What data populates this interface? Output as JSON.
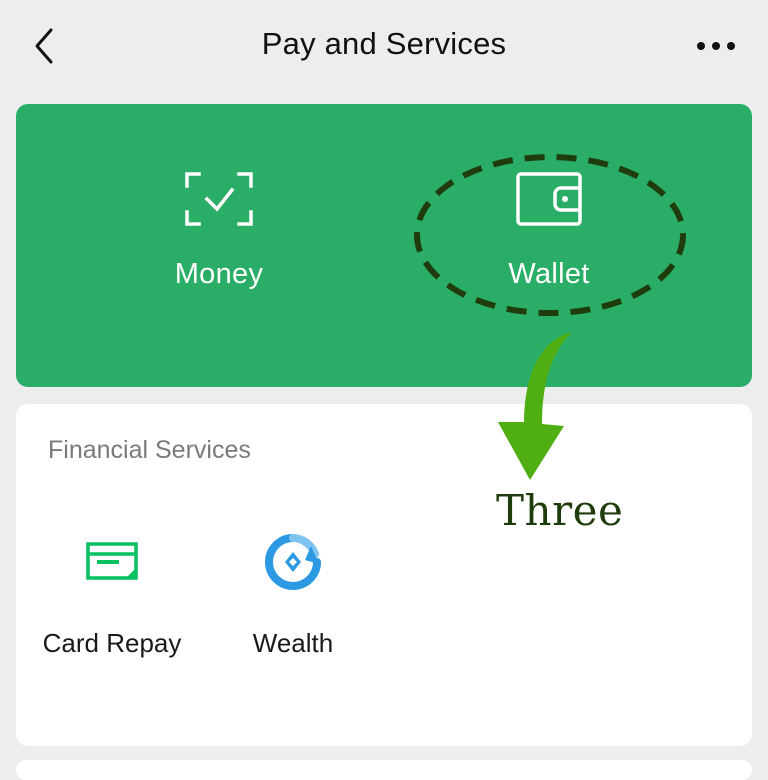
{
  "header": {
    "title": "Pay and Services",
    "back_icon": "chevron-left-icon",
    "more_icon": "more-dots-icon"
  },
  "wallet_panel": {
    "background": "#2aad67",
    "items": [
      {
        "label": "Money",
        "icon": "scan-check-icon"
      },
      {
        "label": "Wallet",
        "icon": "wallet-icon"
      }
    ]
  },
  "financial_services": {
    "title": "Financial Services",
    "items": [
      {
        "label": "Card Repay",
        "icon": "card-repay-icon",
        "color": "#07c160"
      },
      {
        "label": "Wealth",
        "icon": "wealth-icon",
        "color": "#2c9ae3"
      }
    ]
  },
  "annotation": {
    "text": "Three",
    "ellipse_color": "#1f3d0c",
    "arrow_color": "#4fae12"
  }
}
